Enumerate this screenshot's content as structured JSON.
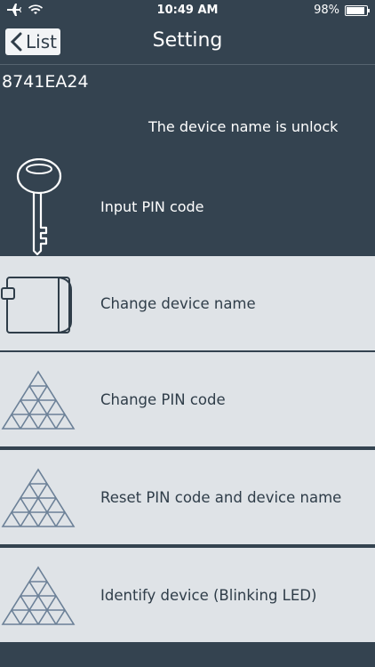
{
  "status": {
    "time": "10:49 AM",
    "battery_percent": "98%",
    "battery_level": 0.98,
    "icons": [
      "airplane-icon",
      "wifi-icon",
      "battery-icon"
    ]
  },
  "nav": {
    "back_label": "List",
    "title": "Setting"
  },
  "device": {
    "id": "8741EA24",
    "status_text": "The device name is unlock"
  },
  "pin": {
    "label": "Input PIN code",
    "icon": "key-icon"
  },
  "menu": [
    {
      "label": "Change device name",
      "icon": "device-icon"
    },
    {
      "label": "Change PIN code",
      "icon": "triangle-grid-icon"
    },
    {
      "label": "Reset PIN code and device name",
      "icon": "triangle-grid-icon"
    },
    {
      "label": "Identify device (Blinking LED)",
      "icon": "triangle-grid-icon"
    }
  ],
  "colors": {
    "dark_bg": "#344350",
    "row_bg": "#dfe3e7",
    "text_dark": "#2f3d49",
    "icon_stroke": "#2f3d49"
  }
}
